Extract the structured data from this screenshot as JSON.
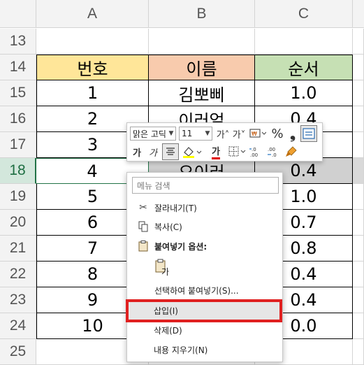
{
  "columns": [
    "A",
    "B",
    "C"
  ],
  "header_row": {
    "row": "14",
    "a": "번호",
    "b": "이름",
    "c": "순서"
  },
  "rows": [
    {
      "row": "13",
      "a": "",
      "b": "",
      "c": ""
    },
    {
      "row": "15",
      "a": "1",
      "b": "김뽀삐",
      "c": "1.0"
    },
    {
      "row": "16",
      "a": "2",
      "b": "이러얼",
      "c": "0.4"
    },
    {
      "row": "17",
      "a": "3",
      "b": "",
      "c": ""
    },
    {
      "row": "18",
      "a": "4",
      "b": "오이러",
      "c": "0.4"
    },
    {
      "row": "19",
      "a": "5",
      "b": "",
      "c": "1.0"
    },
    {
      "row": "20",
      "a": "6",
      "b": "",
      "c": "0.7"
    },
    {
      "row": "21",
      "a": "7",
      "b": "",
      "c": "0.8"
    },
    {
      "row": "22",
      "a": "8",
      "b": "",
      "c": "0.4"
    },
    {
      "row": "23",
      "a": "9",
      "b": "",
      "c": "0.4"
    },
    {
      "row": "24",
      "a": "10",
      "b": "",
      "c": "0.0"
    },
    {
      "row": "25",
      "a": "",
      "b": "",
      "c": ""
    }
  ],
  "mini_toolbar": {
    "font_name": "맑은 고딕",
    "font_size": "11",
    "grow_font": "가˄",
    "shrink_font": "가˅",
    "percent": "%",
    "comma": "❟",
    "bold": "가",
    "italic": "가",
    "font_color_label": "가",
    "dec_increase": "←.0\n.00",
    "dec_decrease": ".00\n→.0"
  },
  "context_menu": {
    "search_placeholder": "메뉴 검색",
    "items": {
      "cut": "잘라내기(T)",
      "copy": "복사(C)",
      "paste_options": "붙여넣기 옵션:",
      "paste_special": "선택하여 붙여넣기(S)...",
      "insert": "삽입(I)",
      "delete": "삭제(D)",
      "clear": "내용 지우기(N)"
    }
  },
  "colors": {
    "highlight": "#e02020",
    "header_a": "#ffe699",
    "header_b": "#f8cbad",
    "header_c": "#c6e0b4",
    "selection": "#217346"
  }
}
